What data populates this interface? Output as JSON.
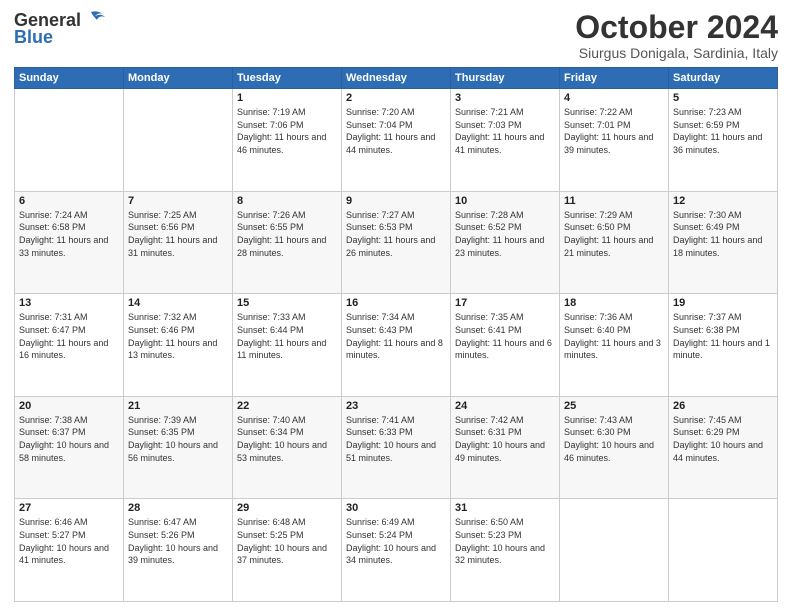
{
  "header": {
    "logo_general": "General",
    "logo_blue": "Blue",
    "month_title": "October 2024",
    "location": "Siurgus Donigala, Sardinia, Italy"
  },
  "days_of_week": [
    "Sunday",
    "Monday",
    "Tuesday",
    "Wednesday",
    "Thursday",
    "Friday",
    "Saturday"
  ],
  "weeks": [
    [
      {
        "day": "",
        "info": ""
      },
      {
        "day": "",
        "info": ""
      },
      {
        "day": "1",
        "info": "Sunrise: 7:19 AM\nSunset: 7:06 PM\nDaylight: 11 hours and 46 minutes."
      },
      {
        "day": "2",
        "info": "Sunrise: 7:20 AM\nSunset: 7:04 PM\nDaylight: 11 hours and 44 minutes."
      },
      {
        "day": "3",
        "info": "Sunrise: 7:21 AM\nSunset: 7:03 PM\nDaylight: 11 hours and 41 minutes."
      },
      {
        "day": "4",
        "info": "Sunrise: 7:22 AM\nSunset: 7:01 PM\nDaylight: 11 hours and 39 minutes."
      },
      {
        "day": "5",
        "info": "Sunrise: 7:23 AM\nSunset: 6:59 PM\nDaylight: 11 hours and 36 minutes."
      }
    ],
    [
      {
        "day": "6",
        "info": "Sunrise: 7:24 AM\nSunset: 6:58 PM\nDaylight: 11 hours and 33 minutes."
      },
      {
        "day": "7",
        "info": "Sunrise: 7:25 AM\nSunset: 6:56 PM\nDaylight: 11 hours and 31 minutes."
      },
      {
        "day": "8",
        "info": "Sunrise: 7:26 AM\nSunset: 6:55 PM\nDaylight: 11 hours and 28 minutes."
      },
      {
        "day": "9",
        "info": "Sunrise: 7:27 AM\nSunset: 6:53 PM\nDaylight: 11 hours and 26 minutes."
      },
      {
        "day": "10",
        "info": "Sunrise: 7:28 AM\nSunset: 6:52 PM\nDaylight: 11 hours and 23 minutes."
      },
      {
        "day": "11",
        "info": "Sunrise: 7:29 AM\nSunset: 6:50 PM\nDaylight: 11 hours and 21 minutes."
      },
      {
        "day": "12",
        "info": "Sunrise: 7:30 AM\nSunset: 6:49 PM\nDaylight: 11 hours and 18 minutes."
      }
    ],
    [
      {
        "day": "13",
        "info": "Sunrise: 7:31 AM\nSunset: 6:47 PM\nDaylight: 11 hours and 16 minutes."
      },
      {
        "day": "14",
        "info": "Sunrise: 7:32 AM\nSunset: 6:46 PM\nDaylight: 11 hours and 13 minutes."
      },
      {
        "day": "15",
        "info": "Sunrise: 7:33 AM\nSunset: 6:44 PM\nDaylight: 11 hours and 11 minutes."
      },
      {
        "day": "16",
        "info": "Sunrise: 7:34 AM\nSunset: 6:43 PM\nDaylight: 11 hours and 8 minutes."
      },
      {
        "day": "17",
        "info": "Sunrise: 7:35 AM\nSunset: 6:41 PM\nDaylight: 11 hours and 6 minutes."
      },
      {
        "day": "18",
        "info": "Sunrise: 7:36 AM\nSunset: 6:40 PM\nDaylight: 11 hours and 3 minutes."
      },
      {
        "day": "19",
        "info": "Sunrise: 7:37 AM\nSunset: 6:38 PM\nDaylight: 11 hours and 1 minute."
      }
    ],
    [
      {
        "day": "20",
        "info": "Sunrise: 7:38 AM\nSunset: 6:37 PM\nDaylight: 10 hours and 58 minutes."
      },
      {
        "day": "21",
        "info": "Sunrise: 7:39 AM\nSunset: 6:35 PM\nDaylight: 10 hours and 56 minutes."
      },
      {
        "day": "22",
        "info": "Sunrise: 7:40 AM\nSunset: 6:34 PM\nDaylight: 10 hours and 53 minutes."
      },
      {
        "day": "23",
        "info": "Sunrise: 7:41 AM\nSunset: 6:33 PM\nDaylight: 10 hours and 51 minutes."
      },
      {
        "day": "24",
        "info": "Sunrise: 7:42 AM\nSunset: 6:31 PM\nDaylight: 10 hours and 49 minutes."
      },
      {
        "day": "25",
        "info": "Sunrise: 7:43 AM\nSunset: 6:30 PM\nDaylight: 10 hours and 46 minutes."
      },
      {
        "day": "26",
        "info": "Sunrise: 7:45 AM\nSunset: 6:29 PM\nDaylight: 10 hours and 44 minutes."
      }
    ],
    [
      {
        "day": "27",
        "info": "Sunrise: 6:46 AM\nSunset: 5:27 PM\nDaylight: 10 hours and 41 minutes."
      },
      {
        "day": "28",
        "info": "Sunrise: 6:47 AM\nSunset: 5:26 PM\nDaylight: 10 hours and 39 minutes."
      },
      {
        "day": "29",
        "info": "Sunrise: 6:48 AM\nSunset: 5:25 PM\nDaylight: 10 hours and 37 minutes."
      },
      {
        "day": "30",
        "info": "Sunrise: 6:49 AM\nSunset: 5:24 PM\nDaylight: 10 hours and 34 minutes."
      },
      {
        "day": "31",
        "info": "Sunrise: 6:50 AM\nSunset: 5:23 PM\nDaylight: 10 hours and 32 minutes."
      },
      {
        "day": "",
        "info": ""
      },
      {
        "day": "",
        "info": ""
      }
    ]
  ]
}
